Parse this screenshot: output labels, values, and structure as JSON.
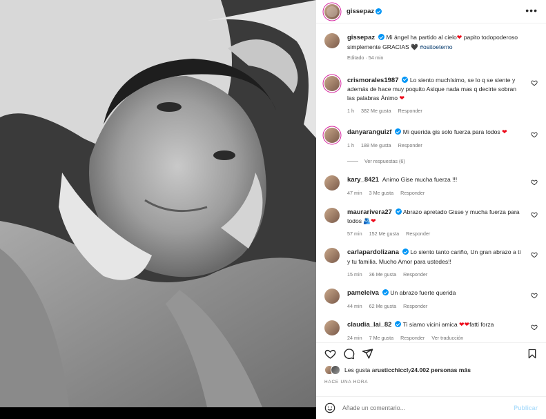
{
  "post": {
    "author": "gissepaz",
    "caption_text": "Mi ángel ha partido al cielo",
    "caption_rest": " papito todopoderoso simplemente GRACIAS ",
    "hashtag": "#ositoeterno",
    "edited": "Editado · 54 min"
  },
  "comments": [
    {
      "user": "crismorales1987",
      "verified": true,
      "text": "Lo siento muchísimo, se lo q se siente y además de hace muy poquito Asique nada mas q decirte sobran las palabras Ánimo",
      "heart": true,
      "time": "1 h",
      "likes": "382 Me gusta",
      "reply": "Responder"
    },
    {
      "user": "danyaranguizf",
      "verified": true,
      "text": "Mi querida gis solo fuerza para todos",
      "heart": true,
      "time": "1 h",
      "likes": "188 Me gusta",
      "reply": "Responder",
      "view_replies": "Ver respuestas (6)"
    },
    {
      "user": "kary_8421",
      "verified": false,
      "text": "Animo Gise mucha fuerza !!!",
      "heart": false,
      "time": "47 min",
      "likes": "3 Me gusta",
      "reply": "Responder"
    },
    {
      "user": "maurarivera27",
      "verified": true,
      "text": "Abrazo apretado Gisse y mucha fuerza para todos",
      "heart": true,
      "time": "57 min",
      "likes": "152 Me gusta",
      "reply": "Responder"
    },
    {
      "user": "carlapardolizana",
      "verified": true,
      "text": "Lo siento tanto cariño, Un gran abrazo a ti y tu familia. Mucho Amor para ustedes!!",
      "heart": false,
      "time": "15 min",
      "likes": "36 Me gusta",
      "reply": "Responder"
    },
    {
      "user": "pameleiva",
      "verified": true,
      "text": "Un abrazo fuerte querida",
      "heart": false,
      "time": "44 min",
      "likes": "62 Me gusta",
      "reply": "Responder"
    },
    {
      "user": "claudia_lai_82",
      "verified": true,
      "text": "Ti siamo vicini amica",
      "text_end": "fatti forza",
      "heart": true,
      "time": "24 min",
      "likes": "7 Me gusta",
      "reply": "Responder",
      "translate": "Ver traducción"
    }
  ],
  "likes_line": {
    "prefix": "Les gusta a ",
    "user": "rusticchiccl",
    "suffix": " y ",
    "count": "24.002 personas más"
  },
  "time_ago": "HACE UNA HORA",
  "add_comment": {
    "placeholder": "Añade un comentario...",
    "post_label": "Publicar"
  },
  "colors": {
    "accent": "#0095f6",
    "heart": "#ed0b1b",
    "hashtag": "#00376b"
  },
  "icons": [
    "more-icon",
    "heart-icon",
    "comment-icon",
    "share-icon",
    "save-icon",
    "emoji-icon"
  ]
}
